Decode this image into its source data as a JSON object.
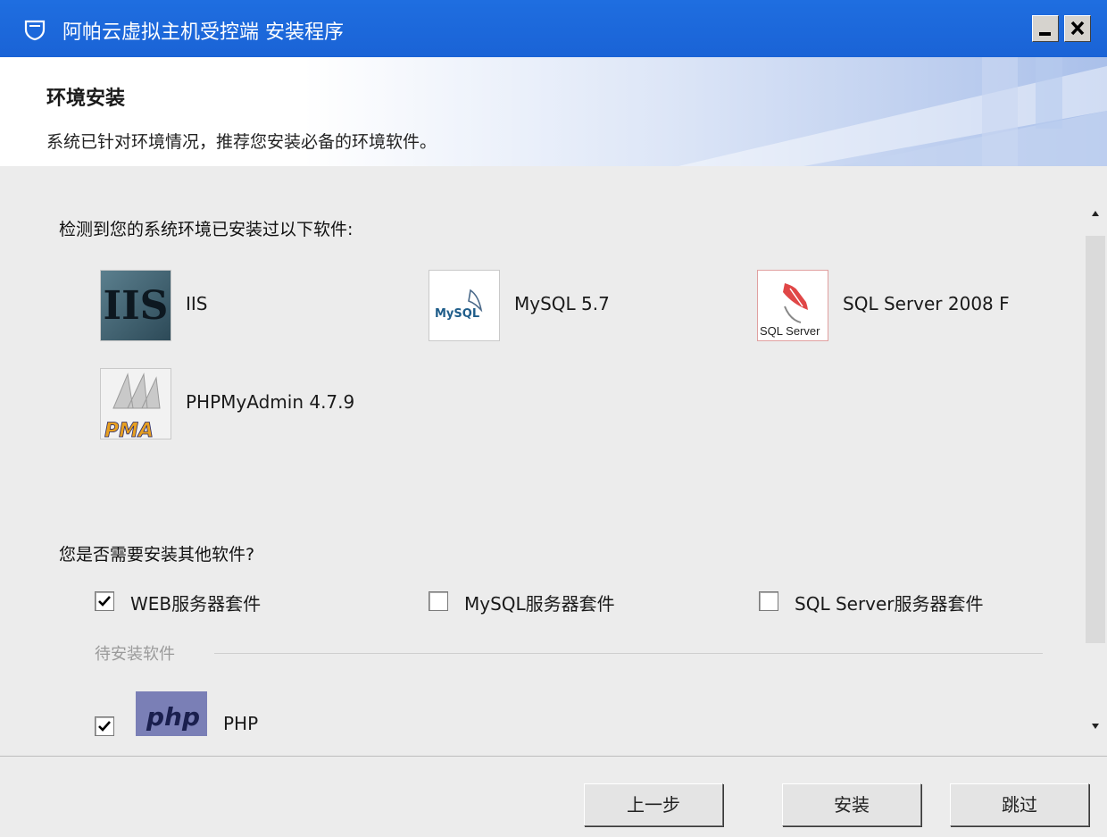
{
  "window": {
    "title": "阿帕云虚拟主机受控端 安装程序",
    "minimize_label": "_",
    "close_label": "x"
  },
  "header": {
    "title": "环境安装",
    "description": "系统已针对环境情况，推荐您安装必备的环境软件。"
  },
  "installed": {
    "heading": "检测到您的系统环境已安装过以下软件:",
    "items": [
      {
        "name": "IIS",
        "logo_text": "IIS",
        "icon": "iis-logo"
      },
      {
        "name": "MySQL 5.7",
        "logo_text": "MySQL",
        "icon": "mysql-logo"
      },
      {
        "name": "SQL Server 2008 F",
        "logo_text": "SQL Server",
        "icon": "sql-server-logo"
      },
      {
        "name": "PHPMyAdmin 4.7.9",
        "logo_text": "PMA",
        "icon": "phpmyadmin-logo"
      }
    ]
  },
  "other": {
    "heading": "您是否需要安装其他软件?",
    "options": [
      {
        "label": "WEB服务器套件",
        "checked": true
      },
      {
        "label": "MySQL服务器套件",
        "checked": false
      },
      {
        "label": "SQL Server服务器套件",
        "checked": false
      }
    ],
    "pending_label": "待安装软件",
    "pending": [
      {
        "name": "PHP",
        "logo_text": "php",
        "checked": true
      }
    ]
  },
  "buttons": {
    "prev": "上一步",
    "install": "安装",
    "skip": "跳过"
  },
  "colors": {
    "titlebar": "#1f6ee0",
    "php_logo": "#7a7fb6"
  }
}
